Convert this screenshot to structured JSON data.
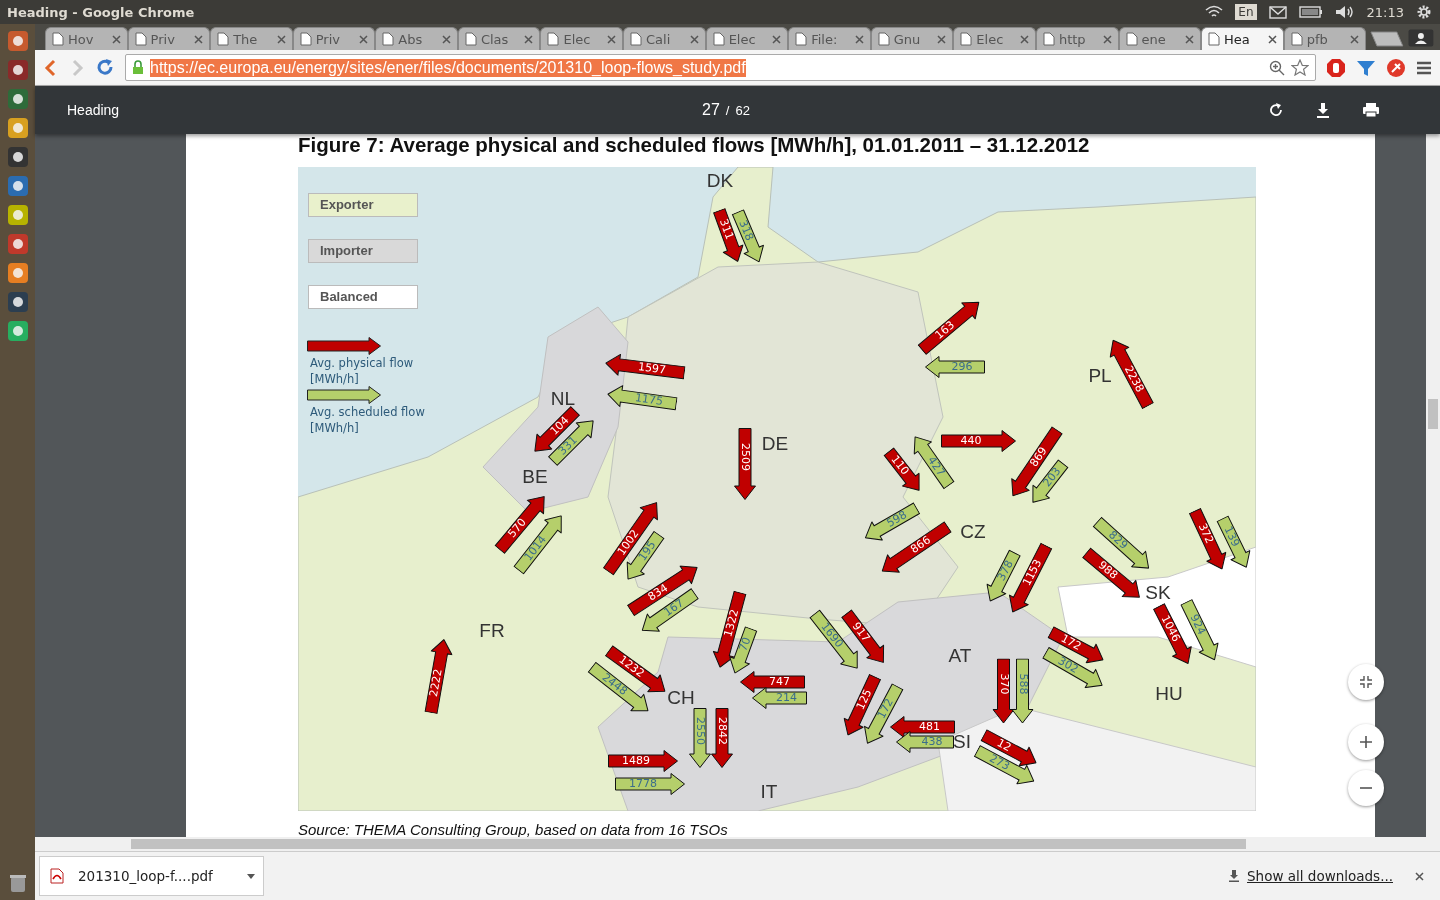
{
  "system_bar": {
    "title": "Heading - Google Chrome",
    "keyboard": "En",
    "clock": "21:13"
  },
  "tabs": [
    {
      "label": "Hov",
      "selected": false
    },
    {
      "label": "Priv",
      "selected": false
    },
    {
      "label": "The",
      "selected": false
    },
    {
      "label": "Priv",
      "selected": false
    },
    {
      "label": "Abs",
      "selected": false
    },
    {
      "label": "Clas",
      "selected": false
    },
    {
      "label": "Elec",
      "selected": false
    },
    {
      "label": "Cali",
      "selected": false
    },
    {
      "label": "Elec",
      "selected": false
    },
    {
      "label": "File:",
      "selected": false
    },
    {
      "label": "Gnu",
      "selected": false
    },
    {
      "label": "Elec",
      "selected": false
    },
    {
      "label": "http",
      "selected": false
    },
    {
      "label": "ene",
      "selected": false
    },
    {
      "label": "Hea",
      "selected": true
    },
    {
      "label": "pfb",
      "selected": false
    }
  ],
  "address_bar": {
    "url": "https://ec.europa.eu/energy/sites/ener/files/documents/201310_loop-flows_study.pdf"
  },
  "pdf_toolbar": {
    "title": "Heading",
    "page": "27",
    "separator": "/",
    "total": "62"
  },
  "figure": {
    "title": "Figure 7: Average physical and scheduled flows [MWh/h], 01.01.2011 – 31.12.2012",
    "legend_boxes": [
      {
        "label": "Exporter",
        "kind": "exporter"
      },
      {
        "label": "Importer",
        "kind": "importer"
      },
      {
        "label": "Balanced",
        "kind": "balanced"
      }
    ],
    "legend_arrows": [
      {
        "kind": "physical",
        "label": "Avg. physical flow\n[MWh/h]"
      },
      {
        "kind": "scheduled",
        "label": "Avg. scheduled flow\n[MWh/h]"
      }
    ],
    "countries": [
      "DK",
      "NL",
      "BE",
      "DE",
      "PL",
      "CZ",
      "SK",
      "FR",
      "AT",
      "HU",
      "CH",
      "SI",
      "IT"
    ],
    "flows": [
      {
        "kind": "physical",
        "value": "311"
      },
      {
        "kind": "scheduled",
        "value": "318"
      },
      {
        "kind": "physical",
        "value": "163"
      },
      {
        "kind": "scheduled",
        "value": "296"
      },
      {
        "kind": "physical",
        "value": "2238"
      },
      {
        "kind": "physical",
        "value": "1597"
      },
      {
        "kind": "scheduled",
        "value": "1175"
      },
      {
        "kind": "physical",
        "value": "104"
      },
      {
        "kind": "scheduled",
        "value": "331"
      },
      {
        "kind": "physical",
        "value": "2509"
      },
      {
        "kind": "physical",
        "value": "110"
      },
      {
        "kind": "scheduled",
        "value": "427"
      },
      {
        "kind": "physical",
        "value": "440"
      },
      {
        "kind": "physical",
        "value": "869"
      },
      {
        "kind": "scheduled",
        "value": "203"
      },
      {
        "kind": "scheduled",
        "value": "598"
      },
      {
        "kind": "physical",
        "value": "866"
      },
      {
        "kind": "scheduled",
        "value": "378"
      },
      {
        "kind": "physical",
        "value": "1153"
      },
      {
        "kind": "scheduled",
        "value": "829"
      },
      {
        "kind": "physical",
        "value": "988"
      },
      {
        "kind": "physical",
        "value": "372"
      },
      {
        "kind": "scheduled",
        "value": "139"
      },
      {
        "kind": "physical",
        "value": "1046"
      },
      {
        "kind": "scheduled",
        "value": "924"
      },
      {
        "kind": "physical",
        "value": "570"
      },
      {
        "kind": "scheduled",
        "value": "1014"
      },
      {
        "kind": "physical",
        "value": "1002"
      },
      {
        "kind": "scheduled",
        "value": "195"
      },
      {
        "kind": "physical",
        "value": "834"
      },
      {
        "kind": "scheduled",
        "value": "167"
      },
      {
        "kind": "physical",
        "value": "2222"
      },
      {
        "kind": "physical",
        "value": "1232"
      },
      {
        "kind": "scheduled",
        "value": "2448"
      },
      {
        "kind": "physical",
        "value": "1322"
      },
      {
        "kind": "scheduled",
        "value": "70"
      },
      {
        "kind": "physical",
        "value": "747"
      },
      {
        "kind": "scheduled",
        "value": "214"
      },
      {
        "kind": "scheduled",
        "value": "2550"
      },
      {
        "kind": "physical",
        "value": "2842"
      },
      {
        "kind": "physical",
        "value": "1489"
      },
      {
        "kind": "scheduled",
        "value": "1778"
      },
      {
        "kind": "scheduled",
        "value": "1690"
      },
      {
        "kind": "physical",
        "value": "917"
      },
      {
        "kind": "physical",
        "value": "125"
      },
      {
        "kind": "scheduled",
        "value": "172"
      },
      {
        "kind": "physical",
        "value": "481"
      },
      {
        "kind": "scheduled",
        "value": "438"
      },
      {
        "kind": "physical",
        "value": "370"
      },
      {
        "kind": "scheduled",
        "value": "588"
      },
      {
        "kind": "physical",
        "value": "172"
      },
      {
        "kind": "scheduled",
        "value": "302"
      },
      {
        "kind": "physical",
        "value": "12"
      },
      {
        "kind": "scheduled",
        "value": "273"
      }
    ],
    "source": "Source: THEMA Consulting Group, based on data from 16 TSOs"
  },
  "downloads": {
    "file": "201310_loop-f....pdf",
    "show_all": "Show all downloads..."
  }
}
